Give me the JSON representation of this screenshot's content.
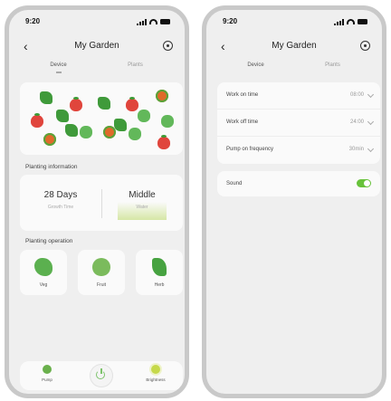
{
  "status": {
    "time": "9:20"
  },
  "header": {
    "title": "My Garden",
    "back_icon": "chevron-left-icon",
    "settings_icon": "settings-circle-icon"
  },
  "tabs": [
    {
      "label": "Device",
      "active": true
    },
    {
      "label": "Plants",
      "active": false
    }
  ],
  "left_screen": {
    "plant_grid": {
      "plants": [
        "herb",
        "strawberry",
        "herb",
        "strawberry",
        "flower",
        "strawberry",
        "lettuce",
        "herb",
        "lettuce",
        "flower",
        "herb",
        "lettuce",
        "flower",
        "lettuce",
        "herb",
        "strawberry"
      ]
    },
    "planting_information": {
      "title": "Planting information",
      "growth_time": {
        "value": "28 Days",
        "label": "Growth Time"
      },
      "water": {
        "value": "Middle",
        "label": "Water"
      }
    },
    "planting_operation": {
      "title": "Planting operation",
      "items": [
        {
          "label": "Veg",
          "icon": "lettuce-icon"
        },
        {
          "label": "Fruit",
          "icon": "strawberry-icon"
        },
        {
          "label": "Herb",
          "icon": "herb-icon"
        }
      ]
    },
    "hint": "",
    "bottom_bar": {
      "pump": {
        "label": "Pump",
        "icon": "drop-icon"
      },
      "power_icon": "power-icon",
      "brightness": {
        "label": "Brightness",
        "icon": "sun-icon"
      }
    }
  },
  "right_screen": {
    "settings_rows": [
      {
        "label": "Work on time",
        "value": "08:00"
      },
      {
        "label": "Work off time",
        "value": "24:00"
      },
      {
        "label": "Pump on frequency",
        "value": "30min"
      }
    ],
    "sound": {
      "label": "Sound",
      "enabled": true
    }
  },
  "colors": {
    "accent_green": "#67c23a",
    "background": "#efefef",
    "card": "#fafafa",
    "frame": "#c9c9c9"
  }
}
